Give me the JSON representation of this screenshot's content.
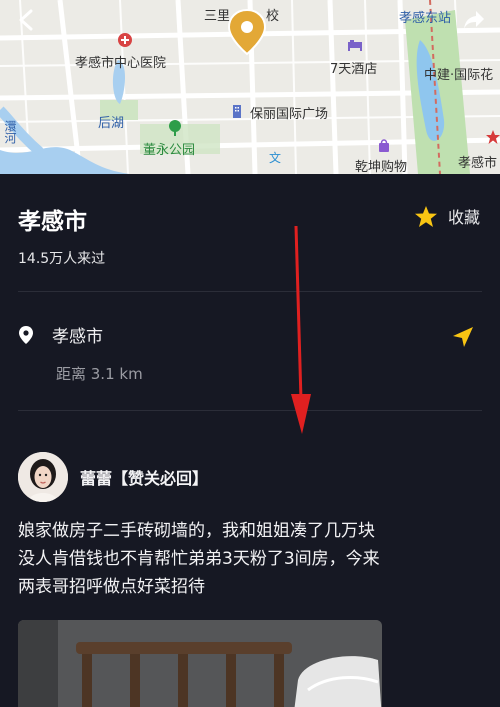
{
  "map": {
    "labels": {
      "top_partial": "三里",
      "school_partial": "校",
      "station": "孝感东站",
      "hospital": "孝感市中心医院",
      "hotel": "7天酒店",
      "bank": "中建·国际花",
      "lake": "后湖",
      "park": "董永公园",
      "plaza": "保丽国际广场",
      "river_partial": "澴河",
      "mall": "乾坤购物",
      "city_right": "孝感市"
    }
  },
  "place": {
    "title": "孝感市",
    "favorite_label": "收藏",
    "visits": "14.5万人来过"
  },
  "location": {
    "name": "孝感市",
    "distance": "距离 3.1 km"
  },
  "post": {
    "username": "蕾蕾【赞关必回】",
    "text_lines": [
      "娘家做房子二手砖砌墙的，我和姐姐凑了几万块",
      "没人肯借钱也不肯帮忙弟弟3天粉了3间房，今来",
      "两表哥招呼做点好菜招待"
    ]
  },
  "colors": {
    "background": "#161823",
    "accent_yellow": "#f9c513",
    "annotation_red": "#e02020"
  }
}
